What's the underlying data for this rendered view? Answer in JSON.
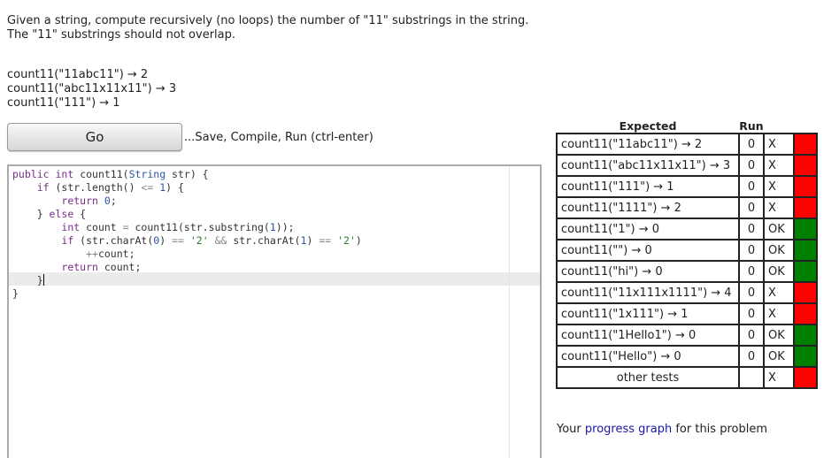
{
  "prompt": {
    "line1": "Given a string, compute recursively (no loops) the number of \"11\" substrings in the string.",
    "line2": "The \"11\" substrings should not overlap."
  },
  "examples": [
    "count11(\"11abc11\") → 2",
    "count11(\"abc11x11x11\") → 3",
    "count11(\"111\") → 1"
  ],
  "go_button": "Go",
  "save_hint": "...Save, Compile, Run (ctrl-enter)",
  "results": {
    "header_expected": "Expected",
    "header_run": "Run",
    "rows": [
      {
        "expected": "count11(\"11abc11\") → 2",
        "run": "0",
        "result": "X",
        "status": "fail"
      },
      {
        "expected": "count11(\"abc11x11x11\") → 3",
        "run": "0",
        "result": "X",
        "status": "fail"
      },
      {
        "expected": "count11(\"111\") → 1",
        "run": "0",
        "result": "X",
        "status": "fail"
      },
      {
        "expected": "count11(\"1111\") → 2",
        "run": "0",
        "result": "X",
        "status": "fail"
      },
      {
        "expected": "count11(\"1\") → 0",
        "run": "0",
        "result": "OK",
        "status": "pass"
      },
      {
        "expected": "count11(\"\") → 0",
        "run": "0",
        "result": "OK",
        "status": "pass"
      },
      {
        "expected": "count11(\"hi\") → 0",
        "run": "0",
        "result": "OK",
        "status": "pass"
      },
      {
        "expected": "count11(\"11x111x1111\") → 4",
        "run": "0",
        "result": "X",
        "status": "fail"
      },
      {
        "expected": "count11(\"1x111\") → 1",
        "run": "0",
        "result": "X",
        "status": "fail"
      },
      {
        "expected": "count11(\"1Hello1\") → 0",
        "run": "0",
        "result": "OK",
        "status": "pass"
      },
      {
        "expected": "count11(\"Hello\") → 0",
        "run": "0",
        "result": "OK",
        "status": "pass"
      }
    ],
    "other": {
      "label": "other tests",
      "run": "",
      "result": "X",
      "status": "fail"
    }
  },
  "progress": {
    "prefix": "Your ",
    "link": "progress graph",
    "suffix": " for this problem"
  },
  "colors": {
    "pass": "#008000",
    "fail": "#ff0000",
    "link": "#1a1aa6"
  }
}
